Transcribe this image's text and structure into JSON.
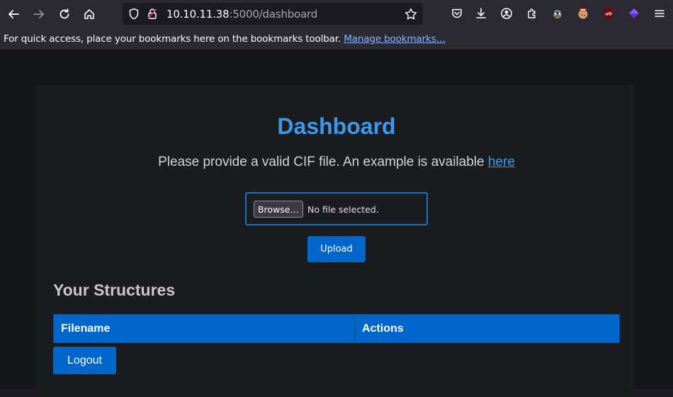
{
  "browser": {
    "url_host": "10.10.11.38",
    "url_path": ":5000/dashboard",
    "bookmarks_message": "For quick access, place your bookmarks here on the bookmarks toolbar.",
    "bookmarks_link": "Manage bookmarks…"
  },
  "page": {
    "title": "Dashboard",
    "subtitle": "Please provide a valid CIF file. An example is available",
    "subtitle_link": "here",
    "browse_label": "Browse…",
    "file_status": "No file selected.",
    "upload_label": "Upload",
    "section_title": "Your Structures",
    "table_headers": [
      "Filename",
      "Actions"
    ],
    "logout_label": "Logout"
  },
  "colors": {
    "accent": "#0066cc",
    "title_blue": "#3e97e8",
    "background": "#1b1c1f"
  }
}
